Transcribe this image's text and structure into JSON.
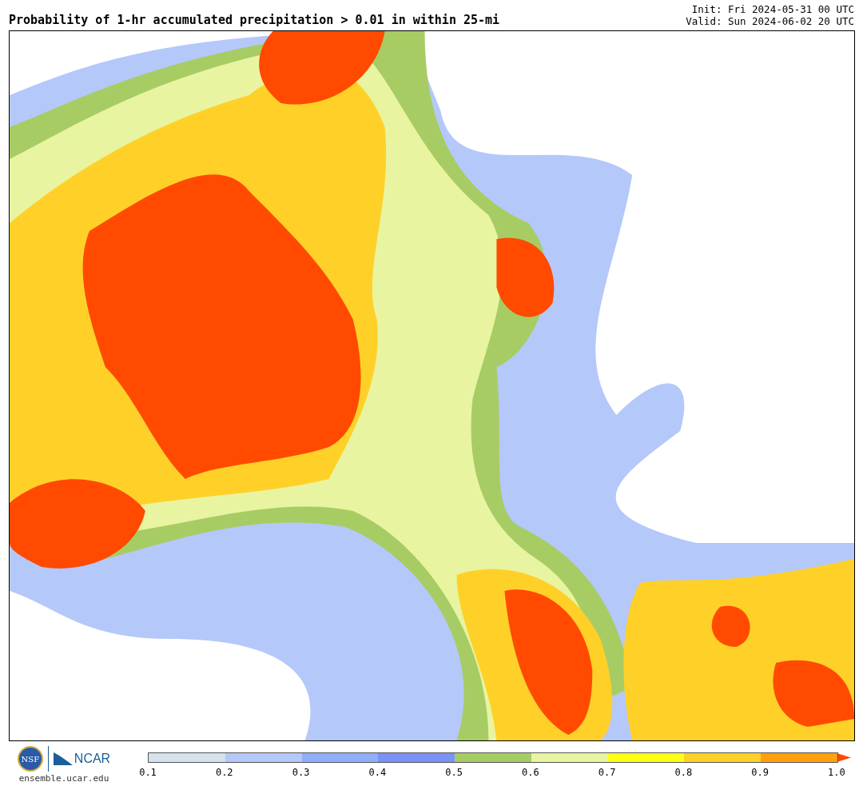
{
  "title": "Probability of 1-hr accumulated precipitation > 0.01 in within 25-mi",
  "init": "Init: Fri 2024-05-31 00 UTC",
  "valid": "Valid: Sun 2024-06-02 20 UTC",
  "logos": {
    "nsf": "NSF",
    "ncar": "NCAR",
    "site": "ensemble.ucar.edu"
  },
  "colorbar": {
    "bins": [
      {
        "color": "#d6e2ed"
      },
      {
        "color": "#b4c8fa"
      },
      {
        "color": "#91aefa"
      },
      {
        "color": "#7b92f6"
      },
      {
        "color": "#a8cc64"
      },
      {
        "color": "#e8f4a0"
      },
      {
        "color": "#ffff16"
      },
      {
        "color": "#ffd128"
      },
      {
        "color": "#ffa00c"
      }
    ],
    "extend_arrow": {
      "color": "#ff4a00"
    },
    "ticks": [
      "0.1",
      "0.2",
      "0.3",
      "0.4",
      "0.5",
      "0.6",
      "0.7",
      "0.8",
      "0.9",
      "1.0"
    ]
  }
}
